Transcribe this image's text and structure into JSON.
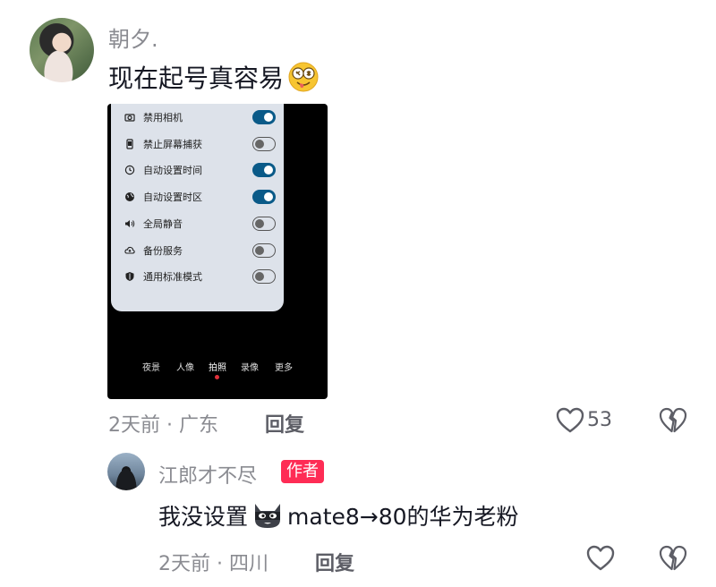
{
  "comment": {
    "username": "朝夕.",
    "text": "现在起号真容易",
    "emoji": "drooling-face-emoji",
    "time_location": "2天前 · 广东",
    "reply_label": "回复",
    "like_count": "53"
  },
  "screenshot": {
    "settings": [
      {
        "icon": "camera-icon",
        "label": "禁用相机",
        "on": true
      },
      {
        "icon": "phone-icon",
        "label": "禁止屏幕捕获",
        "on": false
      },
      {
        "icon": "clock-icon",
        "label": "自动设置时间",
        "on": true
      },
      {
        "icon": "globe-icon",
        "label": "自动设置时区",
        "on": true
      },
      {
        "icon": "volume-icon",
        "label": "全局静音",
        "on": false
      },
      {
        "icon": "cloud-backup-icon",
        "label": "备份服务",
        "on": false
      },
      {
        "icon": "shield-icon",
        "label": "通用标准模式",
        "on": false
      }
    ],
    "camera_modes": [
      "夜景",
      "人像",
      "拍照",
      "录像",
      "更多"
    ],
    "active_mode": "拍照"
  },
  "reply": {
    "username": "江郎才不尽",
    "author_badge": "作者",
    "text_before": "我没设置",
    "emoji": "ninja-cat-emoji",
    "text_after": "mate8→80的华为老粉",
    "time_location": "2天前 · 四川",
    "reply_label": "回复"
  },
  "colors": {
    "accent": "#fe2c55",
    "toggle_on": "#0a5a88",
    "secondary_text": "#8a8b91"
  }
}
